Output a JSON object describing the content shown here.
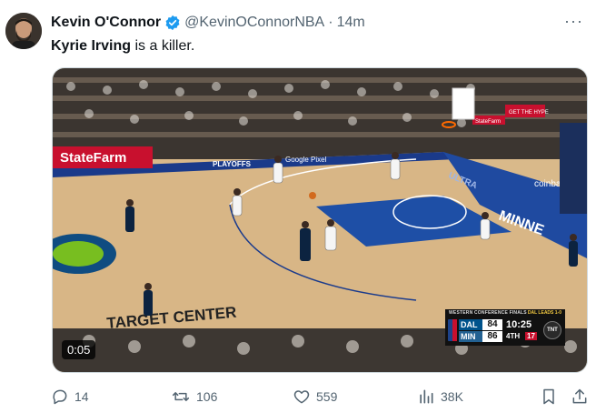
{
  "tweet": {
    "author_name": "Kevin O'Connor",
    "handle": "@KevinOConnorNBA",
    "separator": "·",
    "time": "14m",
    "text_bold": "Kyrie Irving",
    "text_rest": " is a killer.",
    "verified_icon": "verified-badge-icon",
    "more_icon": "more-options-icon",
    "more_label": "···"
  },
  "video": {
    "timestamp": "0:05",
    "court_text": {
      "statefarm": "StateFarm",
      "playoffs": "PLAYOFFS",
      "google_pixel": "Google Pixel",
      "target_center": "TARGET CENTER",
      "minne": "MINNE",
      "ultra": "ULTRA",
      "coinbase": "coinbase",
      "get_the_hype": "GET THE HYPE",
      "statefarm_small": "StateFarm"
    },
    "scorebug": {
      "title": "WESTERN CONFERENCE FINALS",
      "series": "DAL LEADS 1-0",
      "team1": "DAL",
      "team1_score": "84",
      "team2": "MIN",
      "team2_score": "86",
      "clock": "10:25",
      "quarter": "4TH",
      "shot_clock": "17",
      "network": "TNT"
    },
    "colors": {
      "court": "#d9b98a",
      "paint": "#1e4fa6",
      "team_wolves": "#0c2340",
      "team_mavs_home": "#ffffff"
    }
  },
  "actions": {
    "reply_count": "14",
    "retweet_count": "106",
    "like_count": "559",
    "views_count": "38K",
    "icons": [
      "reply-icon",
      "retweet-icon",
      "like-icon",
      "views-icon",
      "bookmark-icon",
      "share-icon"
    ]
  }
}
